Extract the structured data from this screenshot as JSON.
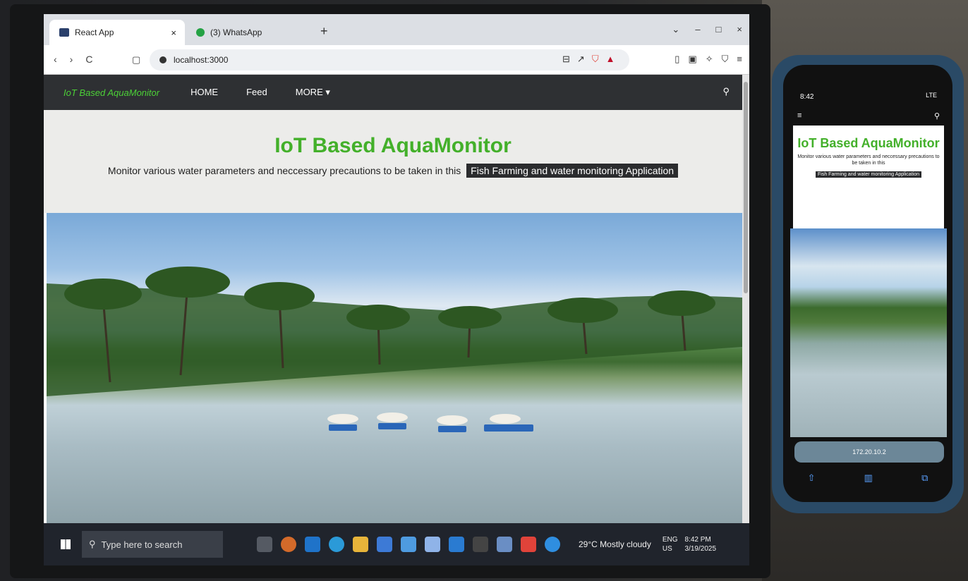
{
  "browser": {
    "tabs": [
      {
        "label": "React App",
        "active": true,
        "close_glyph": "×"
      },
      {
        "label": "(3) WhatsApp",
        "active": false
      }
    ],
    "new_tab_glyph": "+",
    "window_controls": [
      "⌄",
      "–",
      "□",
      "×"
    ],
    "nav_buttons": [
      "‹",
      "›",
      "C"
    ],
    "url": "localhost:3000"
  },
  "site": {
    "brand": "IoT Based AquaMonitor",
    "menu": [
      "HOME",
      "Feed",
      "MORE ▾"
    ],
    "title": "IoT Based AquaMonitor",
    "subtitle": "Monitor various water parameters and neccessary precautions to be taken in this",
    "highlight": "Fish Farming and water monitoring Application"
  },
  "taskbar": {
    "search_placeholder": "Type here to search",
    "weather": "29°C  Mostly cloudy",
    "lang_top": "ENG",
    "lang_bottom": "US",
    "time": "8:42 PM",
    "date": "3/19/2025"
  },
  "phone": {
    "time": "8:42",
    "network": "LTE",
    "title": "IoT Based AquaMonitor",
    "subtitle": "Monitor various water parameters and neccessary precautions to be taken in this",
    "highlight": "Fish Farming and water monitoring Application",
    "url": "172.20.10.2"
  },
  "colors": {
    "brand_green": "#43b02a",
    "nav_bg": "#2e3033",
    "taskbar_bg": "#20242c",
    "phone_case": "#2a4a66"
  },
  "icons": [
    "search-icon",
    "bookmark-icon",
    "refresh-icon",
    "share-icon",
    "tabs-icon",
    "windows-start-icon"
  ]
}
